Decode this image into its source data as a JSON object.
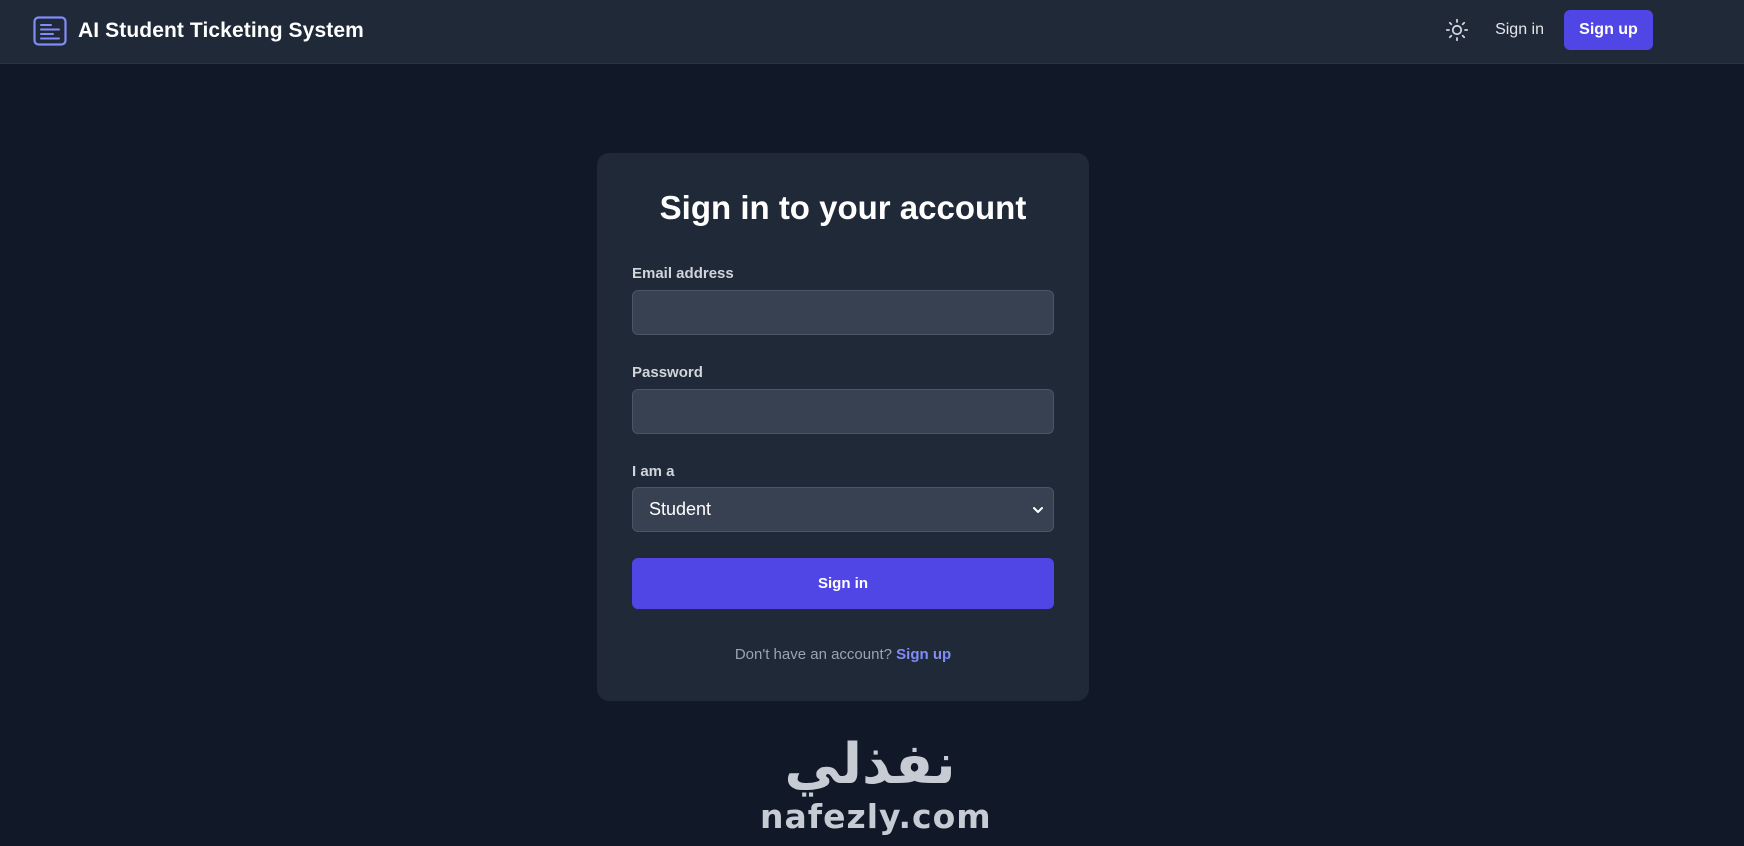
{
  "header": {
    "brand_title": "AI Student Ticketing System",
    "brand_icon": "ticket-menu-icon",
    "theme_icon": "sun-icon",
    "signin_label": "Sign in",
    "signup_label": "Sign up"
  },
  "form": {
    "title": "Sign in to your account",
    "email_label": "Email address",
    "email_value": "",
    "password_label": "Password",
    "password_value": "",
    "role_label": "I am a",
    "role_selected": "Student",
    "submit_label": "Sign in",
    "footer_prompt": "Don't have an account?",
    "footer_link": "Sign up"
  },
  "watermark": {
    "arabic": "نفذلي",
    "latin": "nafezly.com"
  },
  "colors": {
    "background": "#111827",
    "panel": "#1f2937",
    "input": "#374151",
    "accent": "#4f46e5",
    "link": "#818cf8"
  }
}
